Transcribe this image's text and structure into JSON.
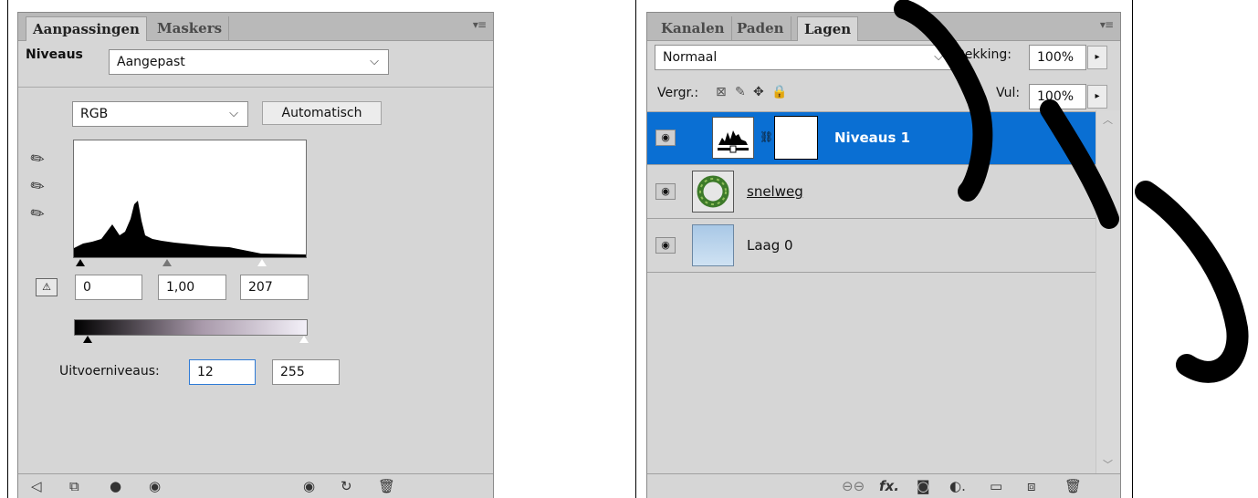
{
  "adjustments": {
    "tabs": [
      "Aanpassingen",
      "Maskers"
    ],
    "preset_label": "Niveaus",
    "preset_value": "Aangepast",
    "channel_value": "RGB",
    "auto_button": "Automatisch",
    "input_levels": [
      "0",
      "1,00",
      "207"
    ],
    "output_label": "Uitvoerniveaus:",
    "output_levels": [
      "12",
      "255"
    ]
  },
  "layers": {
    "tabs": [
      "Kanalen",
      "Paden",
      "Lagen"
    ],
    "blend_mode": "Normaal",
    "opacity_label": "Dekking:",
    "opacity_value": "100%",
    "lock_label": "Vergr.:",
    "fill_label": "Vul:",
    "fill_value": "100%",
    "rows": [
      {
        "name": "Niveaus 1",
        "selected": true
      },
      {
        "name": "snelweg",
        "selected": false
      },
      {
        "name": "Laag 0",
        "selected": false
      }
    ]
  },
  "colors": {
    "selection": "#0a6fd3",
    "panel": "#d6d6d6"
  }
}
